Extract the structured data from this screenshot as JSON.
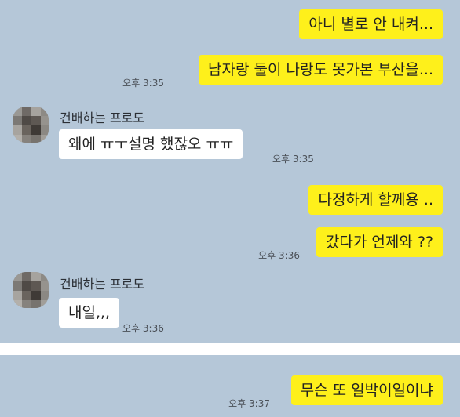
{
  "chat": {
    "messages": [
      {
        "text": "아니 별로 안 내켜..."
      },
      {
        "text": "남자랑 둘이 나랑도 못가본 부산을...",
        "time": "오후 3:35"
      },
      {
        "sender": "건배하는 프로도",
        "text": "왜에 ㅠㅜ설명 했잖오 ㅠㅠ",
        "time": "오후 3:35"
      },
      {
        "text": "다정하게 할께용 .."
      },
      {
        "text": "갔다가 언제와 ??",
        "time": "오후 3:36"
      },
      {
        "sender": "건배하는 프로도",
        "text": "내일,,,",
        "time": "오후 3:36"
      },
      {
        "text": "무슨 또 일박이일이냐",
        "time": "오후 3:37"
      }
    ]
  },
  "colors": {
    "chat_background": "#b5c7d8",
    "outgoing_bubble": "#fef01b",
    "incoming_bubble": "#ffffff"
  },
  "icons": {
    "avatar": "pixelated-profile-photo"
  }
}
